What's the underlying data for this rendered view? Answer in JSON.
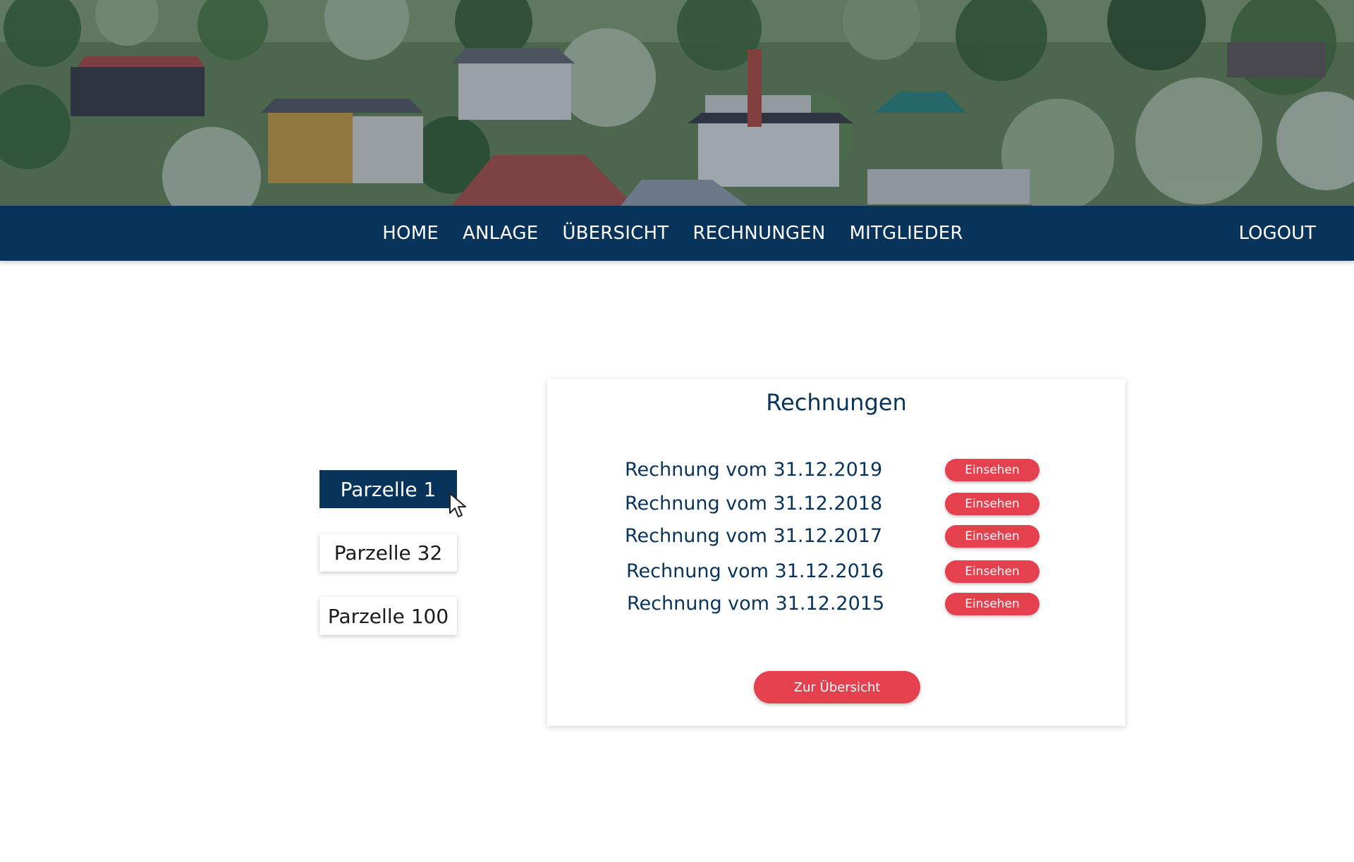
{
  "hero": {
    "image": "allotment-garden-photo"
  },
  "nav": {
    "links": [
      {
        "label": "HOME"
      },
      {
        "label": "ANLAGE"
      },
      {
        "label": "ÜBERSICHT"
      },
      {
        "label": "RECHNUNGEN"
      },
      {
        "label": "MITGLIEDER"
      }
    ],
    "logout": "LOGOUT"
  },
  "parcels": [
    {
      "label": "Parzelle 1",
      "selected": true
    },
    {
      "label": "Parzelle 32",
      "selected": false
    },
    {
      "label": "Parzelle 100",
      "selected": false
    }
  ],
  "invoices": {
    "title": "Rechnungen",
    "items": [
      {
        "label": "Rechnung vom 31.12.2019",
        "action": "Einsehen"
      },
      {
        "label": "Rechnung vom 31.12.2018",
        "action": "Einsehen"
      },
      {
        "label": "Rechnung vom 31.12.2017",
        "action": "Einsehen"
      },
      {
        "label": "Rechnung vom 31.12.2016",
        "action": "Einsehen"
      },
      {
        "label": "Rechnung vom 31.12.2015",
        "action": "Einsehen"
      }
    ],
    "overview_button": "Zur Übersicht"
  },
  "colors": {
    "navy": "#08335a",
    "accent_red": "#e5404e",
    "background": "#ffffff"
  },
  "icons": {
    "cursor": "mouse-pointer-icon"
  }
}
